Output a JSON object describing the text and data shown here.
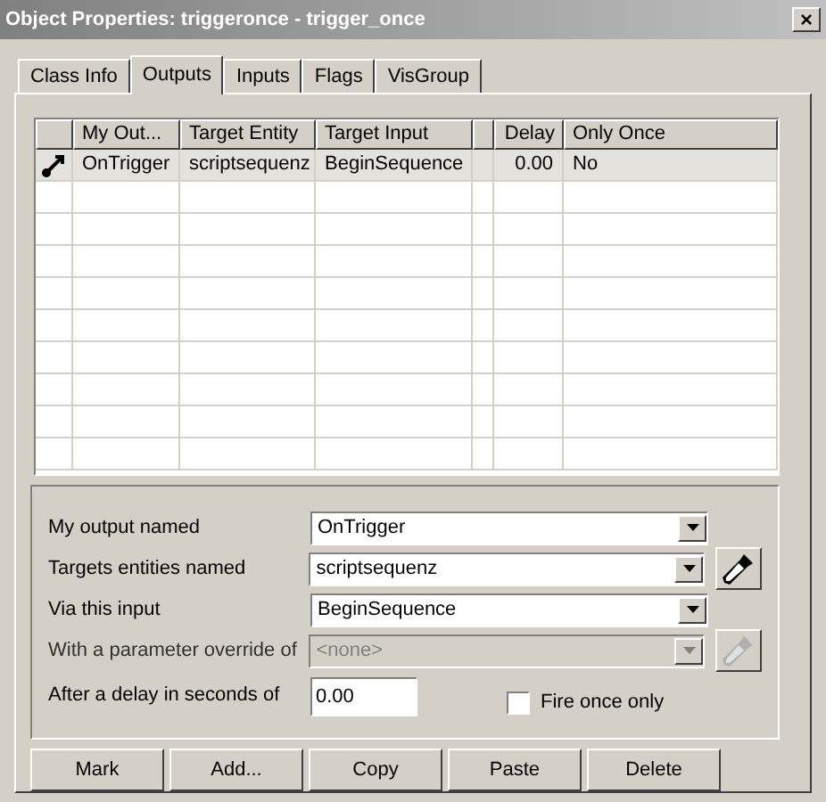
{
  "window": {
    "title": "Object Properties: triggeronce - trigger_once",
    "close": "×"
  },
  "tabs": [
    {
      "label": "Class Info",
      "selected": false
    },
    {
      "label": "Outputs",
      "selected": true
    },
    {
      "label": "Inputs",
      "selected": false
    },
    {
      "label": "Flags",
      "selected": false
    },
    {
      "label": "VisGroup",
      "selected": false
    }
  ],
  "table": {
    "columns": [
      "My Out...",
      "Target Entity",
      "Target Input",
      "",
      "Delay",
      "Only Once"
    ],
    "rows": [
      {
        "selected": true,
        "cells": [
          "OnTrigger",
          "scriptsequenz",
          "BeginSequence",
          "",
          "0.00",
          "No"
        ]
      }
    ]
  },
  "form": {
    "fields": [
      {
        "label": "My output named",
        "value": "OnTrigger",
        "disabled": false,
        "picker": false
      },
      {
        "label": "Targets entities named",
        "value": "scriptsequenz",
        "disabled": false,
        "picker": true
      },
      {
        "label": "Via this input",
        "value": "BeginSequence",
        "disabled": false,
        "picker": false
      },
      {
        "label": "With a parameter override of",
        "value": "<none>",
        "disabled": true,
        "picker": true
      }
    ],
    "delay": {
      "label": "After a delay in seconds of",
      "value": "0.00"
    },
    "fire_once": {
      "label": "Fire once only",
      "checked": false
    }
  },
  "buttons": [
    "Mark",
    "Add...",
    "Copy",
    "Paste",
    "Delete"
  ]
}
